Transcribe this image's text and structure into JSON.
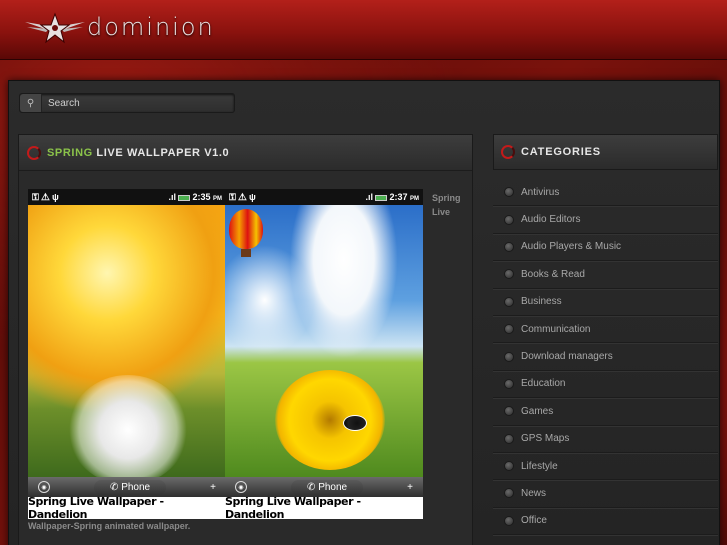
{
  "header": {
    "logo_text": "dominion"
  },
  "search": {
    "placeholder": "Search"
  },
  "post": {
    "title_accent": "SPRING",
    "title_rest": " LIVE WALLPAPER V1.0",
    "screens": [
      {
        "time": "2:35",
        "ampm": "PM",
        "phone_label": "Phone",
        "caption": "Spring Live Wallpaper - Dandelion"
      },
      {
        "time": "2:37",
        "ampm": "PM",
        "phone_label": "Phone",
        "caption": "Spring Live Wallpaper - Dandelion"
      }
    ],
    "side_text": "Spring Live",
    "below_text": "Wallpaper-Spring animated wallpaper."
  },
  "categories": {
    "title": "CATEGORIES",
    "items": [
      "Antivirus",
      "Audio Editors",
      "Audio Players & Music",
      "Books & Read",
      "Business",
      "Communication",
      "Download managers",
      "Education",
      "Games",
      "GPS Maps",
      "Lifestyle",
      "News",
      "Office"
    ]
  },
  "colors": {
    "accent_green": "#8bc34a",
    "accent_red": "#c31a1a"
  }
}
